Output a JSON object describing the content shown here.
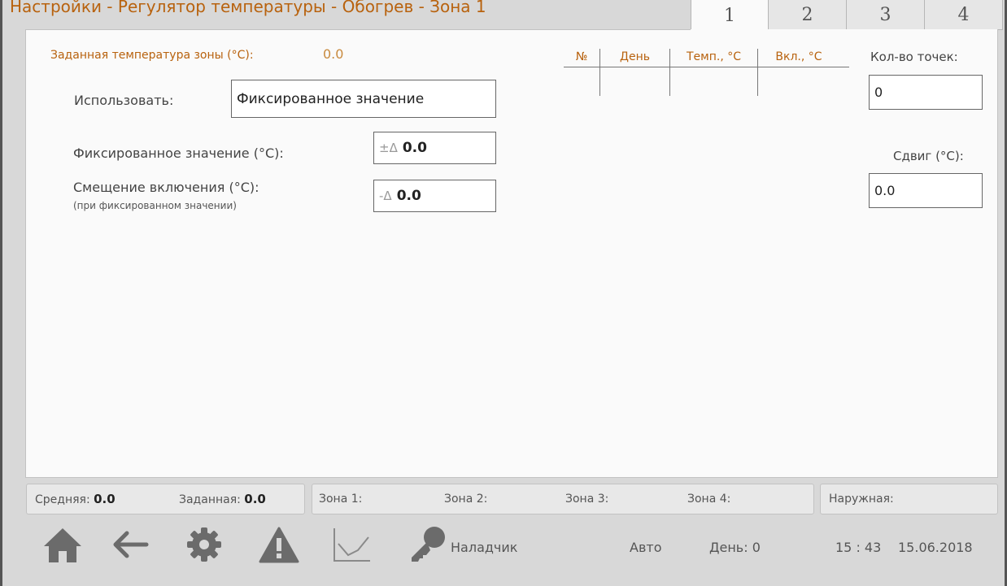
{
  "header": {
    "title": "Настройки - Регулятор температуры - Обогрев - Зона 1",
    "tabs": [
      "1",
      "2",
      "3",
      "4"
    ],
    "active_tab": "1"
  },
  "setpoint": {
    "label": "Заданная температура зоны (°C):",
    "value": "0.0"
  },
  "use": {
    "label": "Использовать:",
    "value": "Фиксированное значение"
  },
  "fixed": {
    "label": "Фиксированное значение (°C):",
    "prefix": "±Δ",
    "value": "0.0"
  },
  "offset": {
    "label": "Смещение включения (°C):",
    "sublabel": "(при фиксированном значении)",
    "prefix": "-Δ",
    "value": "0.0"
  },
  "schedule": {
    "columns": [
      "№",
      "День",
      "Темп., °C",
      "Вкл., °C"
    ]
  },
  "points": {
    "label": "Кол-во точек:",
    "value": "0"
  },
  "shift": {
    "label": "Сдвиг (°C):",
    "value": "0.0"
  },
  "status": {
    "avg_label": "Средняя:",
    "avg_value": "0.0",
    "set_label": "Заданная:",
    "set_value": "0.0",
    "zones": [
      "Зона 1:",
      "Зона 2:",
      "Зона 3:",
      "Зона 4:"
    ],
    "outside_label": "Наружная:"
  },
  "toolbar": {
    "icons": [
      "home-icon",
      "back-arrow-icon",
      "gear-icon",
      "warning-icon",
      "chart-icon",
      "key-icon"
    ],
    "user": "Наладчик",
    "mode": "Авто",
    "day": "День: 0",
    "time": "15 : 43",
    "date": "15.06.2018"
  },
  "colors": {
    "accent": "#b8620e",
    "background": "#d8d8d8",
    "panel": "#fafafa",
    "icon": "#6b6b6b"
  }
}
